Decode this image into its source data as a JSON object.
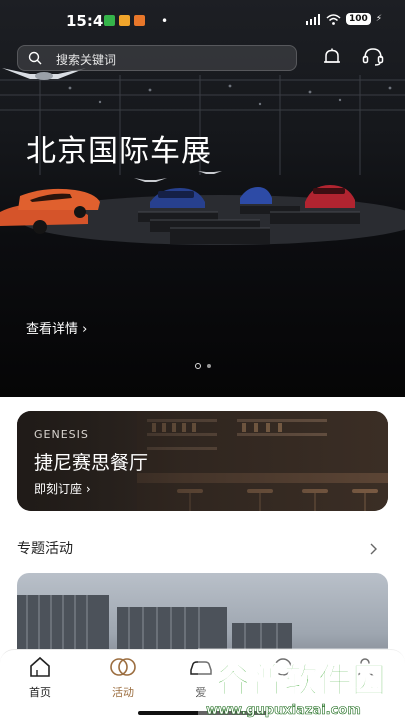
{
  "status_bar": {
    "time": "15:49",
    "battery": "100"
  },
  "header": {
    "search_placeholder": "搜索关键词"
  },
  "hero": {
    "title": "北京国际车展",
    "link_label": "查看详情 ›",
    "page_count": 2,
    "active_page": 1
  },
  "restaurant": {
    "brand": "GENESIS",
    "name": "捷尼赛思餐厅",
    "action": "即刻订座 ›"
  },
  "section": {
    "title": "专题活动"
  },
  "tabs": [
    {
      "label": "首页",
      "icon": "home-icon",
      "active": false
    },
    {
      "label": "活动",
      "icon": "rings-icon",
      "active": true
    },
    {
      "label": "爱",
      "icon": "car-icon",
      "active": false
    }
  ],
  "watermark": {
    "text": "谷普软件园",
    "url": "www.gupuxiazai.com"
  },
  "colors": {
    "accent": "#9b6d3f",
    "hero_bg": "#0c0d10"
  }
}
